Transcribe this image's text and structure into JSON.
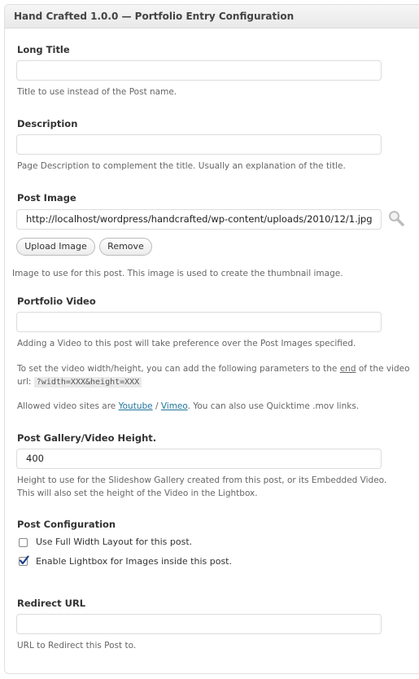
{
  "panel": {
    "title": "Hand Crafted 1.0.0 — Portfolio Entry Configuration"
  },
  "long_title": {
    "label": "Long Title",
    "value": "",
    "hint": "Title to use instead of the Post name."
  },
  "description": {
    "label": "Description",
    "value": "",
    "hint": "Page Description to complement the title. Usually an explanation of the title."
  },
  "post_image": {
    "label": "Post Image",
    "value": "http://localhost/wordpress/handcrafted/wp-content/uploads/2010/12/1.jpg",
    "upload_label": "Upload Image",
    "remove_label": "Remove",
    "hint": "Image to use for this post. This image is used to create the thumbnail image."
  },
  "portfolio_video": {
    "label": "Portfolio Video",
    "value": "",
    "hint1": "Adding a Video to this post will take preference over the Post Images specified.",
    "hint2_pre": "To set the video width/height, you can add the following parameters to the ",
    "hint2_end": "end",
    "hint2_post": " of the video",
    "hint2_url": "url:",
    "hint2_code": "?width=XXX&height=XXX",
    "hint3_pre": "Allowed video sites are ",
    "youtube": "Youtube",
    "sep": " / ",
    "vimeo": "Vimeo",
    "hint3_post": ". You can also use Quicktime .mov links."
  },
  "gallery_height": {
    "label": "Post Gallery/Video Height.",
    "value": "400",
    "hint1": "Height to use for the Slideshow Gallery created from this post, or its Embedded Video.",
    "hint2": "This will also set the height of the Video in the Lightbox."
  },
  "post_config": {
    "label": "Post Configuration",
    "full_width": {
      "label": "Use Full Width Layout for this post.",
      "checked": false
    },
    "lightbox": {
      "label": "Enable Lightbox for Images inside this post.",
      "checked": true
    }
  },
  "redirect": {
    "label": "Redirect URL",
    "value": "",
    "hint": "URL to Redirect this Post to."
  }
}
